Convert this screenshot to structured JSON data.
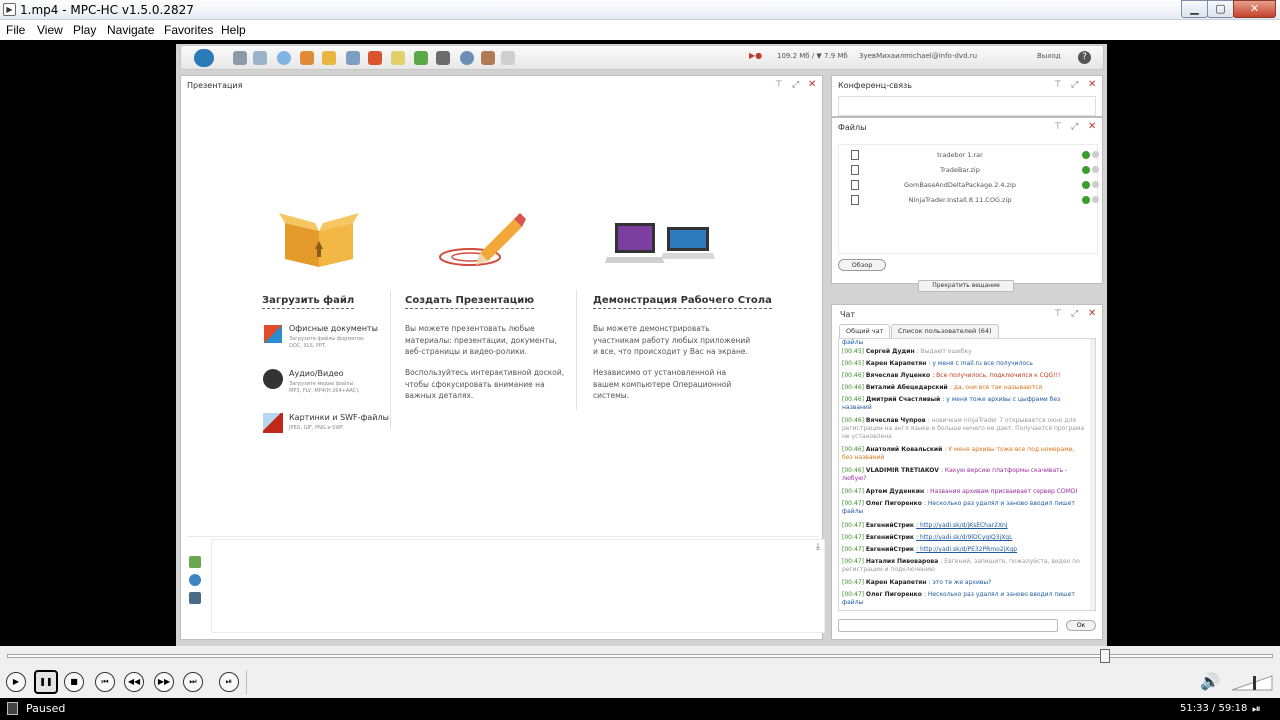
{
  "window": {
    "title": "1.mp4 - MPC-HC v1.5.0.2827",
    "icon": "mpc-app-icon"
  },
  "window_buttons": {
    "minimize": "▁",
    "maximize": "▢",
    "close": "✕"
  },
  "menu": [
    "File",
    "View",
    "Play",
    "Navigate",
    "Favorites",
    "Help"
  ],
  "webinar_toolbar": {
    "traffic": "109.2 Мб / ▼ 7.9 Мб",
    "user": "ЗуевМихаилmichael@info-dvd.ru",
    "logout": "Выход",
    "help": "?"
  },
  "presentation": {
    "title": "Презентация",
    "upload": {
      "title": "Загрузить файл",
      "items": [
        {
          "title": "Офисные документы",
          "text1": "Загрузите файлы форматов:",
          "text2": "DOC, XLS, PPT."
        },
        {
          "title": "Аудио/Видео",
          "text1": "Загрузите медиа файлы:",
          "text2": "MP3, FLV, MP4(H.264+AAC)."
        },
        {
          "title": "Картинки и SWF-файлы",
          "text1": "JPEG, GIF, PNG и SWF.",
          "text2": ""
        }
      ]
    },
    "create": {
      "title": "Создать Презентацию",
      "p1": "Вы можете презентовать любые материалы: презентации, документы, веб-страницы и видео-ролики.",
      "p2": "Воспользуйтесь интерактивной доской, чтобы сфокусировать внимание на важных деталях."
    },
    "desktop": {
      "title": "Демонстрация Рабочего Стола",
      "p1": "Вы можете демонстрировать участникам работу любых приложений и все, что происходит у Вас на экране.",
      "p2": "Независимо от установленной на вашем компьютере Операционной системы."
    }
  },
  "conference": {
    "title": "Конференц-связь"
  },
  "files": {
    "title": "Файлы",
    "items": [
      "tradebor 1.rar",
      "TradeBar.zip",
      "GomBaseAndDeltaPackage.2.4.zip",
      "NinjaTrader.Install.8.11.COG.zip"
    ],
    "browse": "Обзор",
    "stop_broadcast": "Прекратить вещание"
  },
  "chat": {
    "title": "Чат",
    "tabs": [
      "Общий чат",
      "Список пользователей (64)"
    ],
    "messages": [
      {
        "time": "",
        "user": "",
        "text": "файлы",
        "color": "c-blue"
      },
      {
        "time": "[00:45]",
        "user": "Сергей Дудин",
        "text": ": Выдают ошибку",
        "color": "c-gray"
      },
      {
        "time": "[00:45]",
        "user": "Карен Карапетян",
        "text": ": у меня с mail.ru все получилось",
        "color": "c-blue"
      },
      {
        "time": "[00:46]",
        "user": "Вячеслав Луценко",
        "text": ": Все получилось, подключился к  CQG!!!",
        "color": "c-red"
      },
      {
        "time": "[00:46]",
        "user": "Виталий Абецедарский",
        "text": ": да, они все так называются",
        "color": "c-orange"
      },
      {
        "time": "[00:46]",
        "user": "Дмитрий Счастливый",
        "text": ": у меня тоже архивы с цыфрами без названий",
        "color": "c-blue"
      },
      {
        "time": "[00:46]",
        "user": "Вячеслав Чупров",
        "text": ": новичкам ninjaTrader 7 открывается окно для регистрации на англ языке и больше ничего не дает. Получается програма не установлена",
        "color": "c-gray"
      },
      {
        "time": "[00:46]",
        "user": "Анатолий Ковальский",
        "text": ": У меня архивы тоже все под номерами, без названий",
        "color": "c-orange"
      },
      {
        "time": "[00:46]",
        "user": "VLADIMIR TRETIAKOV",
        "text": ": Какую версию платформы скачивать - любую?",
        "color": "c-purple"
      },
      {
        "time": "[00:47]",
        "user": "Артем Дуденкин",
        "text": ": Названия архивам присваивает сервер COMDI",
        "color": "c-purple"
      },
      {
        "time": "[00:47]",
        "user": "Олег Пигоренко",
        "text": ": Несколько раз удалял и заново вводил пишет файлы",
        "color": "c-blue"
      },
      {
        "time": "[00:47]",
        "user": "ЕвгенийСтрик",
        "text": ": http://yadi.sk/d/jKsEChar2Xnj",
        "color": "c-link"
      },
      {
        "time": "[00:47]",
        "user": "ЕвгенийСтрик",
        "text": ": http://yadi.sk/d/9IDCyqIQ3jXgL",
        "color": "c-link"
      },
      {
        "time": "[00:47]",
        "user": "ЕвгенийСтрик",
        "text": ": http://yadi.sk/d/PE32PRmo2jXgp",
        "color": "c-link"
      },
      {
        "time": "[00:47]",
        "user": "Наталия Пивоварова",
        "text": ": Евгений, запишите, пожалуйста, видео по регистрации и подключению",
        "color": "c-gray"
      },
      {
        "time": "[00:47]",
        "user": "Карен Карапетян",
        "text": ": это те же архивы?",
        "color": "c-blue"
      },
      {
        "time": "[00:47]",
        "user": "Олег Пигоренко",
        "text": ": Несколько раз удалял и заново вводил пишет файлы",
        "color": "c-blue"
      }
    ],
    "ok": "Ок"
  },
  "player": {
    "buttons": [
      "▶",
      "❚❚",
      "■",
      "⏮",
      "◀◀",
      "▶▶",
      "⏭",
      "⏯"
    ],
    "seek_fraction": 0.867,
    "volume_icon": "speaker-icon"
  },
  "status": {
    "state": "Paused",
    "time": "51:33 / 59:18",
    "end_icon": "⏯"
  }
}
